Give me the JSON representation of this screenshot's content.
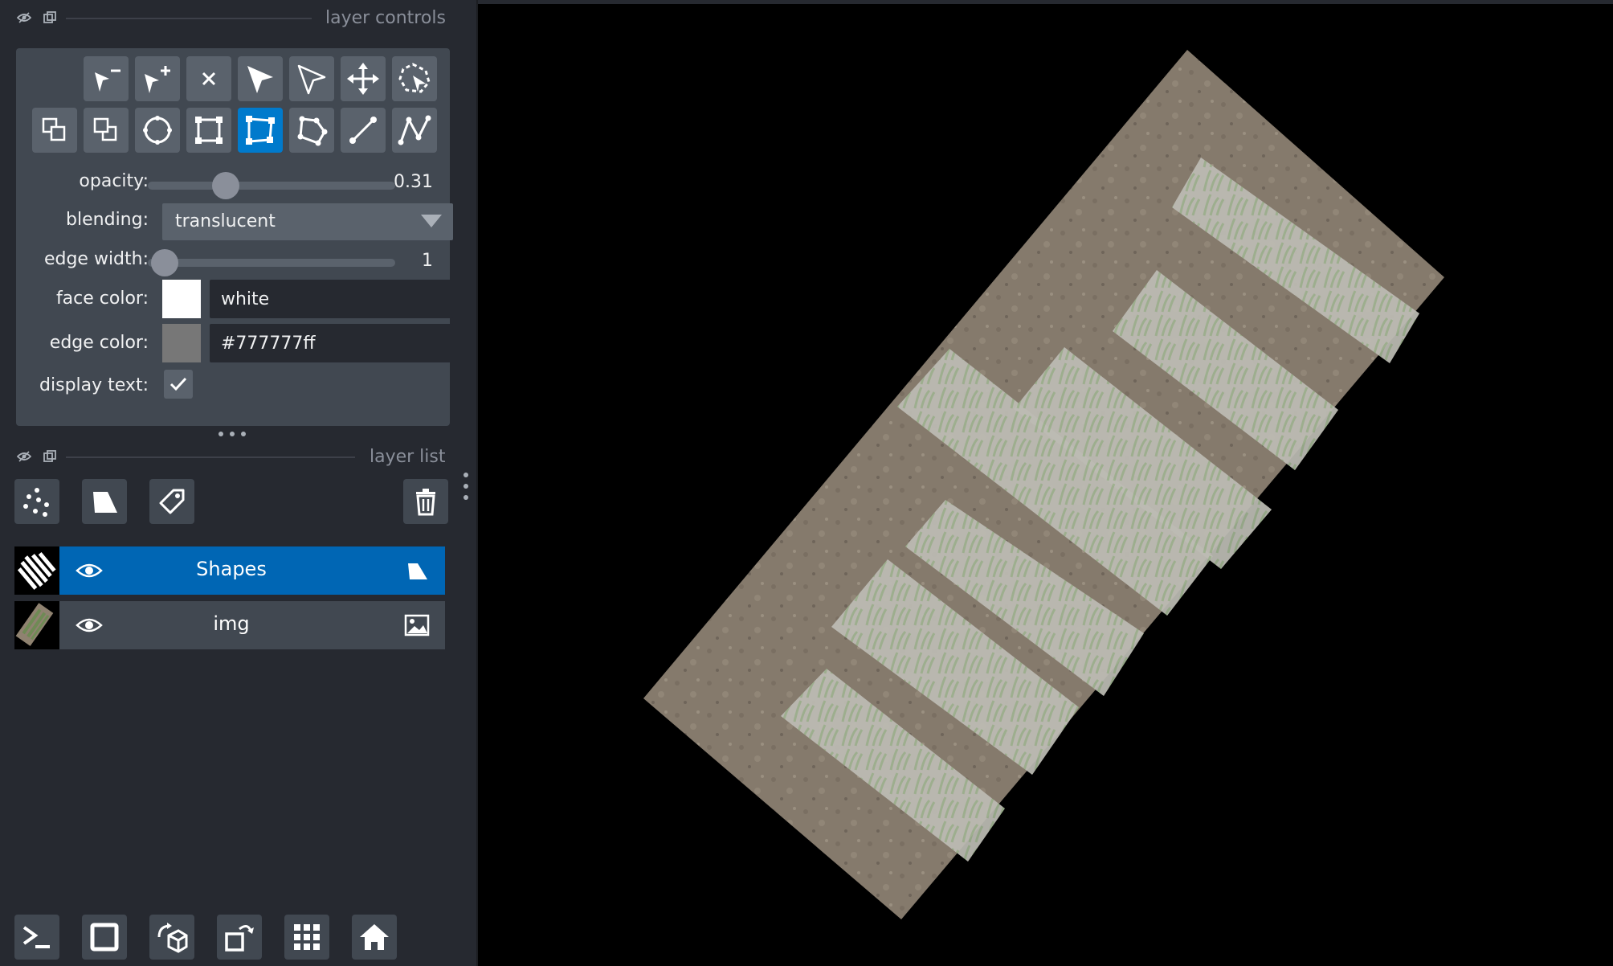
{
  "layer_controls": {
    "title": "layer controls",
    "opacity": {
      "label": "opacity:",
      "value": "0.31",
      "fraction": 0.31
    },
    "blending": {
      "label": "blending:",
      "value": "translucent"
    },
    "edge_width": {
      "label": "edge width:",
      "value": "1"
    },
    "face_color": {
      "label": "face color:",
      "value": "white",
      "swatch": "#ffffff"
    },
    "edge_color": {
      "label": "edge color:",
      "value": "#777777ff",
      "swatch": "#777777"
    },
    "display_text": {
      "label": "display text:",
      "checked": true
    },
    "tool_buttons_row1": [
      "remove-vertex-icon",
      "add-vertex-icon",
      "delete-shape-icon",
      "select-shapes-icon",
      "direct-select-icon",
      "pan-zoom-icon",
      "lasso-select-icon"
    ],
    "tool_buttons_row2": [
      "move-front-icon",
      "move-back-icon",
      "ellipse-icon",
      "rectangle-icon",
      "rectangle-vertex-icon",
      "polygon-icon",
      "line-icon",
      "path-icon"
    ],
    "active_tool": "rectangle-vertex-icon"
  },
  "layer_list": {
    "title": "layer list",
    "layers": [
      {
        "name": "Shapes",
        "selected": true,
        "type_icon": "shapes-layer-icon",
        "visible": true
      },
      {
        "name": "img",
        "selected": false,
        "type_icon": "image-layer-icon",
        "visible": true
      }
    ]
  },
  "colors": {
    "accent": "#007acc",
    "selected_row": "#0066b4",
    "panel": "#262930",
    "box": "#414851"
  }
}
